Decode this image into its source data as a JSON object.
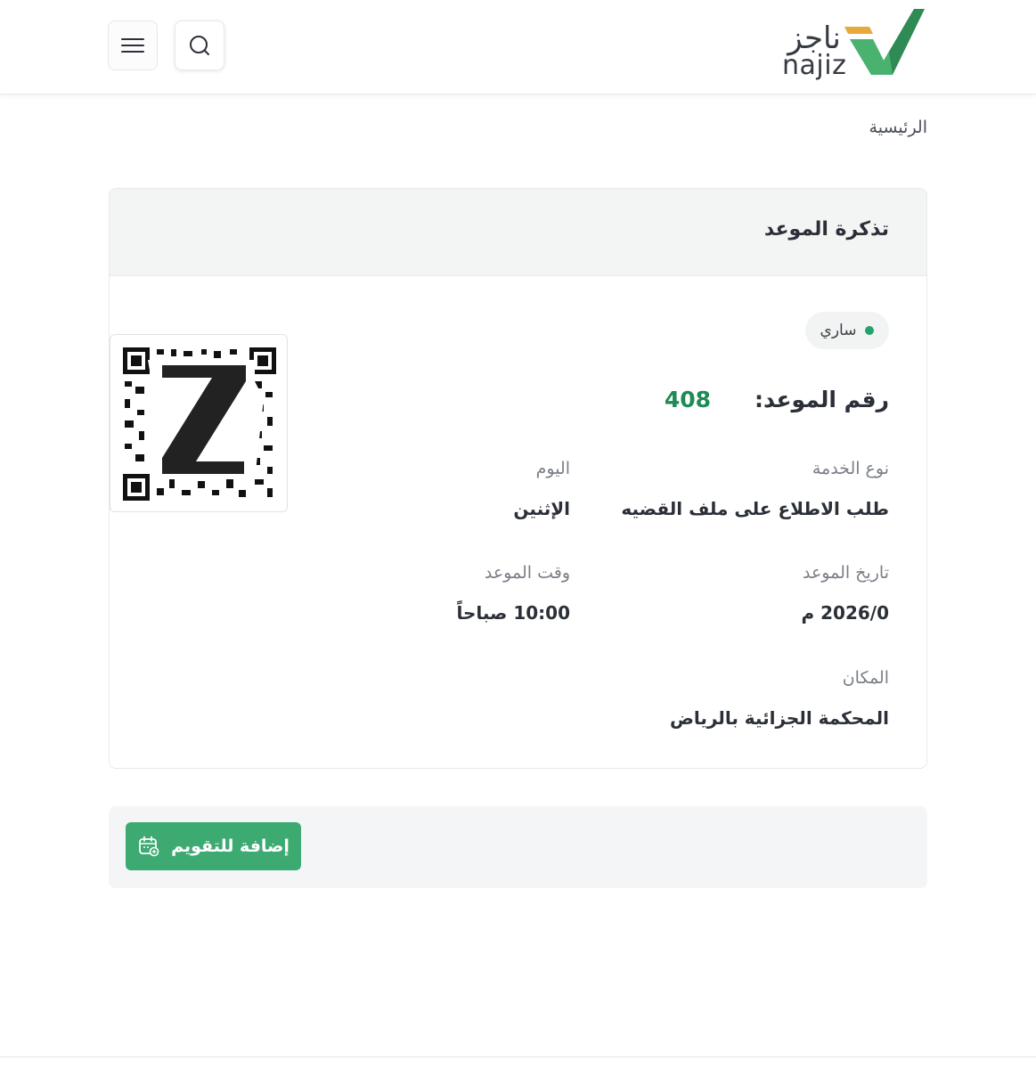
{
  "header": {
    "logo_ar": "ناجز",
    "logo_en": "najiz",
    "search_icon": "search-icon",
    "menu_icon": "hamburger-menu-icon"
  },
  "breadcrumb": {
    "home": "الرئيسية"
  },
  "card": {
    "title": "تذكرة الموعد",
    "status": "ساري",
    "appointment_number_label": "رقم الموعد:",
    "appointment_number_value": "408",
    "service_type_label": "نوع الخدمة",
    "service_type_value": "طلب الاطلاع على ملف القضيه",
    "day_label": "اليوم",
    "day_value": "الإثنين",
    "date_label": "تاريخ الموعد",
    "date_value": "2026/0 م",
    "time_label": "وقت الموعد",
    "time_value": "10:00 صباحاً",
    "location_label": "المكان",
    "location_value": "المحكمة الجزائية بالرياض"
  },
  "actions": {
    "add_to_calendar": "إضافة للتقويم",
    "calendar_icon": "calendar-add-icon"
  },
  "colors": {
    "brand_green": "#3daa72",
    "number_green": "#1e8a54",
    "status_dot": "#22a36b",
    "logo_gold": "#e6a93a"
  }
}
